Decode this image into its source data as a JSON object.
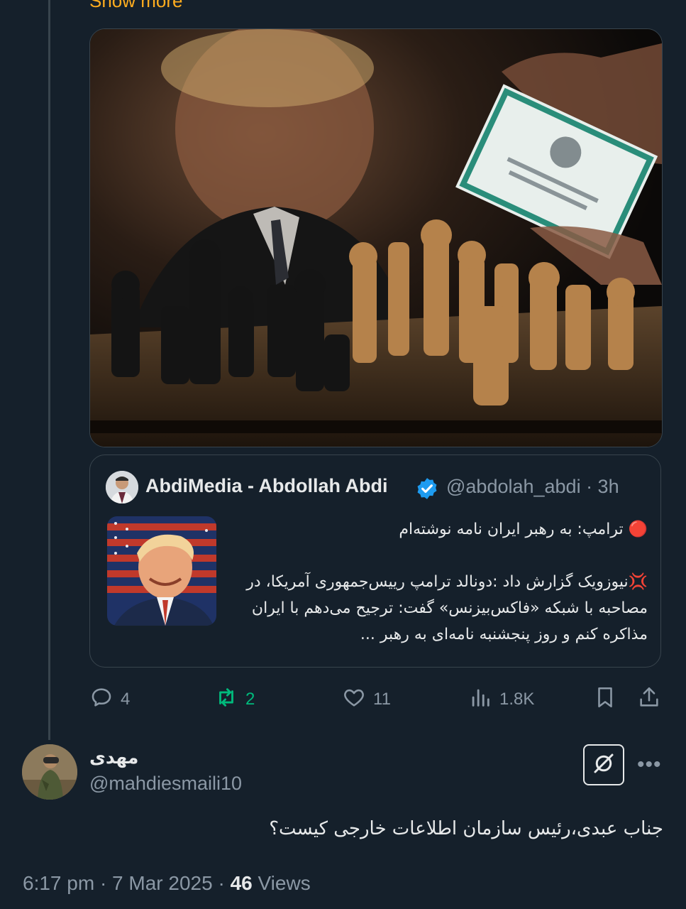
{
  "thread": {
    "show_more": "Show more"
  },
  "quoted_tweet": {
    "author_name": "AbdiMedia - Abdollah Abdi",
    "handle_and_time": "@abdolah_abdi · 3h",
    "text": "🔴 ترامپ: به رهبر ایران نامه نوشته‌ام\n\n💢نیوزویک گزارش داد :دونالد ترامپ رییس‌جمهوری آمریکا، در مصاحبه با شبکه «فاکس‌بیزنس» گفت: ترجیح می‌دهم با ایران مذاکره کنم و روز پنجشنبه نامه‌ای به رهبر ..."
  },
  "actions": {
    "replies": "4",
    "retweets": "2",
    "likes": "11",
    "views": "1.8K"
  },
  "reply": {
    "author_name": "مهدی",
    "handle": "@mahdiesmaili10",
    "text": "جناب عبدی،رئیس سازمان اطلاعات خارجی کیست؟",
    "time": "6:17 pm · 7 Mar 2025 · ",
    "views_count": "46",
    "views_label": " Views"
  },
  "colors": {
    "background": "#15202b",
    "text_primary": "#e7e9ea",
    "text_secondary": "#8b98a5",
    "retweet_green": "#00ba7c",
    "verified_blue": "#1d9bf0",
    "border": "#38444d"
  },
  "icons": [
    "reply-icon",
    "retweet-icon",
    "like-icon",
    "views-icon",
    "bookmark-icon",
    "share-icon",
    "verified-icon",
    "grok-icon",
    "more-icon"
  ]
}
